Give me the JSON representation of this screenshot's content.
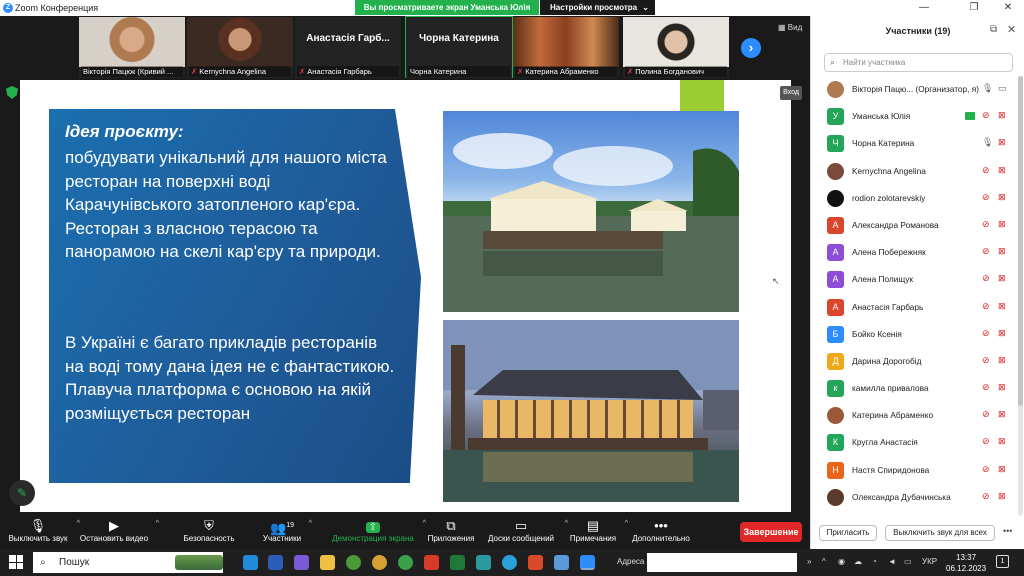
{
  "window": {
    "title": "Zoom Конференция",
    "share_banner": "Вы просматриваете экран Уманська Юлія",
    "view_settings": "Настройки просмотра"
  },
  "strip": {
    "view_label": "Вид",
    "tiles": [
      {
        "name": "Вікторія Пацюк (Кривий ...",
        "big": "",
        "muted": false
      },
      {
        "name": "Kernychna Angelina",
        "big": "",
        "muted": true
      },
      {
        "name": "Анастасія Гарбарь",
        "big": "Анастасія Гарб...",
        "muted": true
      },
      {
        "name": "Чорна Катерина",
        "big": "Чорна Катерина",
        "muted": false
      },
      {
        "name": "Катерина Абраменко",
        "big": "",
        "muted": true
      },
      {
        "name": "Полина Богданович",
        "big": "",
        "muted": true
      }
    ]
  },
  "slide": {
    "heading": "Ідея проєкту:",
    "para1": "побудувати унікальний для нашого міста ресторан на поверхні  воді Карачунівського затопленого кар'єра. Ресторан з власною терасою та панорамою на скелі кар'єру та природи.",
    "para2": "В Україні є багато прикладів ресторанів на воді тому дана ідея не є фантастикою. Плавуча платформа є основою на якій розміщується ресторан",
    "enter": "Вход"
  },
  "toolbar": {
    "mute": "Выключить звук",
    "video": "Остановить видео",
    "security": "Безопасность",
    "participants": "Участники",
    "participants_count": "19",
    "share": "Демонстрация экрана",
    "apps": "Приложения",
    "whiteboards": "Доски сообщений",
    "notes": "Примечания",
    "more": "Дополнительно",
    "end": "Завершение"
  },
  "panel": {
    "title": "Участники (19)",
    "search_placeholder": "Найти участника",
    "invite": "Пригласить",
    "mute_all": "Выключить звук для всех",
    "participants": [
      {
        "name": "Вікторія Пацю...  (Организатор, я)",
        "avatar": "",
        "color": "#b07a50",
        "photo": true,
        "mic_on": true,
        "cam_on": true,
        "share": false
      },
      {
        "name": "Уманська Юлія",
        "avatar": "У",
        "color": "#23a55a",
        "photo": false,
        "mic_on": false,
        "cam_on": false,
        "share": true
      },
      {
        "name": "Чорна Катерина",
        "avatar": "Ч",
        "color": "#23a55a",
        "photo": false,
        "mic_on": true,
        "cam_on": false,
        "share": false
      },
      {
        "name": "Kernychna Angelina",
        "avatar": "",
        "color": "#7a4a3a",
        "photo": true,
        "mic_on": false,
        "cam_on": false,
        "share": false
      },
      {
        "name": "rodion zolotarevskiy",
        "avatar": "",
        "color": "#111111",
        "photo": true,
        "mic_on": false,
        "cam_on": false,
        "share": false
      },
      {
        "name": "Александра Романова",
        "avatar": "А",
        "color": "#d9462b",
        "photo": false,
        "mic_on": false,
        "cam_on": false,
        "share": false
      },
      {
        "name": "Алена Побережняк",
        "avatar": "А",
        "color": "#8e4dd6",
        "photo": false,
        "mic_on": false,
        "cam_on": false,
        "share": false
      },
      {
        "name": "Алена Полищук",
        "avatar": "А",
        "color": "#8e4dd6",
        "photo": false,
        "mic_on": false,
        "cam_on": false,
        "share": false
      },
      {
        "name": "Анастасія Гарбарь",
        "avatar": "А",
        "color": "#d9462b",
        "photo": false,
        "mic_on": false,
        "cam_on": false,
        "share": false
      },
      {
        "name": "Бойко Ксенія",
        "avatar": "Б",
        "color": "#2d8cff",
        "photo": false,
        "mic_on": false,
        "cam_on": false,
        "share": false
      },
      {
        "name": "Дарина Дорогобід",
        "avatar": "Д",
        "color": "#f0a81a",
        "photo": false,
        "mic_on": false,
        "cam_on": false,
        "share": false
      },
      {
        "name": "камилла привалова",
        "avatar": "к",
        "color": "#23a55a",
        "photo": false,
        "mic_on": false,
        "cam_on": false,
        "share": false
      },
      {
        "name": "Катерина Абраменко",
        "avatar": "",
        "color": "#9a5a3a",
        "photo": true,
        "mic_on": false,
        "cam_on": false,
        "share": false
      },
      {
        "name": "Кругла Анастасія",
        "avatar": "К",
        "color": "#23a55a",
        "photo": false,
        "mic_on": false,
        "cam_on": false,
        "share": false
      },
      {
        "name": "Настя Спиридонова",
        "avatar": "Н",
        "color": "#e8661a",
        "photo": false,
        "mic_on": false,
        "cam_on": false,
        "share": false
      },
      {
        "name": "Олександра Дубачинська",
        "avatar": "",
        "color": "#5a3a2a",
        "photo": true,
        "mic_on": false,
        "cam_on": false,
        "share": false
      }
    ]
  },
  "taskbar": {
    "search": "Пошук",
    "address": "Адреса",
    "lang": "УКР",
    "time": "13:37",
    "date": "06.12.2023"
  }
}
